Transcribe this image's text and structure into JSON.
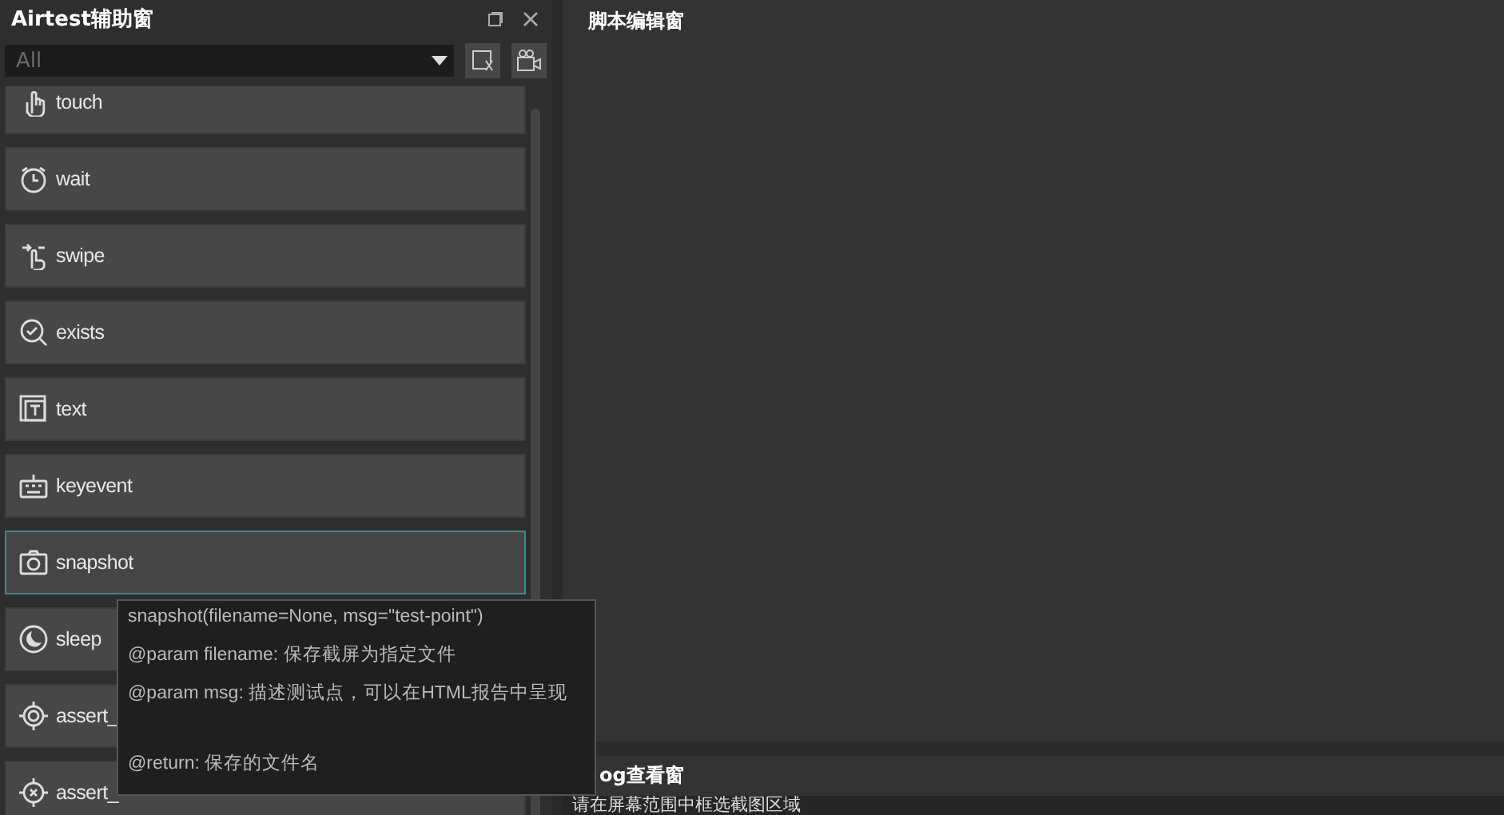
{
  "helper_panel": {
    "title": "Airtest辅助窗",
    "filter": {
      "placeholder": "All"
    },
    "items": [
      {
        "label": "touch",
        "kind": "touch",
        "selected": false
      },
      {
        "label": "wait",
        "kind": "wait",
        "selected": false
      },
      {
        "label": "swipe",
        "kind": "swipe",
        "selected": false
      },
      {
        "label": "exists",
        "kind": "exists",
        "selected": false
      },
      {
        "label": "text",
        "kind": "text",
        "selected": false
      },
      {
        "label": "keyevent",
        "kind": "keyevent",
        "selected": false
      },
      {
        "label": "snapshot",
        "kind": "snapshot",
        "selected": true
      },
      {
        "label": "sleep",
        "kind": "sleep",
        "selected": false
      },
      {
        "label": "assert_",
        "kind": "assert",
        "selected": false
      },
      {
        "label": "assert_",
        "kind": "assert_not",
        "selected": false
      }
    ],
    "tooltip": {
      "signature": "snapshot(filename=None, msg=\"test-point\")",
      "params": [
        "@param filename: 保存截屏为指定文件",
        "@param msg: 描述测试点，可以在HTML报告中呈现"
      ],
      "returns": "@return: 保存的文件名"
    }
  },
  "editor": {
    "title": "脚本编辑窗"
  },
  "log": {
    "title": "og查看窗",
    "message": "请在屏幕范围中框选截图区域"
  }
}
